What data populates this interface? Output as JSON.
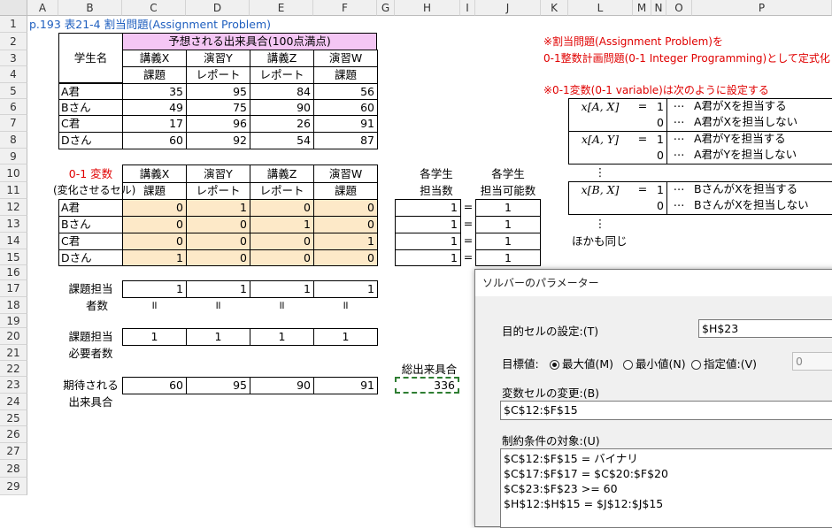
{
  "columns": [
    "A",
    "B",
    "C",
    "D",
    "E",
    "F",
    "G",
    "H",
    "I",
    "J",
    "K",
    "L",
    "M",
    "N",
    "O",
    "P"
  ],
  "rows": [
    "1",
    "2",
    "3",
    "4",
    "5",
    "6",
    "7",
    "8",
    "9",
    "10",
    "11",
    "12",
    "13",
    "14",
    "15",
    "16",
    "17",
    "18",
    "19",
    "20",
    "21",
    "22",
    "23",
    "24",
    "25",
    "26",
    "27",
    "28",
    "29"
  ],
  "title": "p.193 表21-4 割当問題(Assignment Problem)",
  "expected_header": "予想される出来具合(100点満点)",
  "student_label": "学生名",
  "lectures": [
    {
      "top": "講義X",
      "bottom": "課題"
    },
    {
      "top": "演習Y",
      "bottom": "レポート"
    },
    {
      "top": "講義Z",
      "bottom": "レポート"
    },
    {
      "top": "演習W",
      "bottom": "課題"
    }
  ],
  "students": [
    "A君",
    "Bさん",
    "C君",
    "Dさん"
  ],
  "scores": [
    [
      "35",
      "95",
      "84",
      "56"
    ],
    [
      "49",
      "75",
      "90",
      "60"
    ],
    [
      "17",
      "96",
      "26",
      "91"
    ],
    [
      "60",
      "92",
      "54",
      "87"
    ]
  ],
  "var_label": "0-1 変数",
  "var_sub": "(変化させるセル)",
  "assignment": [
    [
      "0",
      "1",
      "0",
      "0"
    ],
    [
      "0",
      "0",
      "1",
      "0"
    ],
    [
      "0",
      "0",
      "0",
      "1"
    ],
    [
      "1",
      "0",
      "0",
      "0"
    ]
  ],
  "each_student_top": "各学生",
  "count_label": "担当数",
  "possible_label": "担当可能数",
  "assigned_counts": [
    "1",
    "1",
    "1",
    "1"
  ],
  "eq": "=",
  "possible_counts": [
    "1",
    "1",
    "1",
    "1"
  ],
  "task_count_label1": "課題担当",
  "task_count_label2": "者数",
  "task_counts": [
    "1",
    "1",
    "1",
    "1"
  ],
  "eqv": "॥",
  "needed_label1": "課題担当",
  "needed_label2": "必要者数",
  "needed": [
    "1",
    "1",
    "1",
    "1"
  ],
  "expected_label1": "期待される",
  "expected_label2": "出来具合",
  "expected_values": [
    "60",
    "95",
    "90",
    "91"
  ],
  "total_label": "総出来具合",
  "total_value": "336",
  "notes": {
    "line1": "※割当問題(Assignment Problem)を",
    "line2": "0-1整数計画問題(0-1 Integer Programming)として定式化",
    "line3": "※0-1変数(0-1 variable)は次のように設定する",
    "x_ax": "x[A, X]",
    "x_ay": "x[A, Y]",
    "x_bx": "x[B, X]",
    "eq": "=",
    "one": "1",
    "zero": "0",
    "ellipsis": "⋯",
    "vdots": "⋮",
    "ax1": "A君がXを担当する",
    "ax0": "A君がXを担当しない",
    "ay1": "A君がYを担当する",
    "ay0": "A君がYを担当しない",
    "bx1": "BさんがXを担当する",
    "bx0": "BさんがXを担当しない",
    "others": "ほかも同じ"
  },
  "solver": {
    "title": "ソルバーのパラメーター",
    "objective_label": "目的セルの設定:(T)",
    "objective_value": "$H$23",
    "target_label": "目標値:",
    "max_label": "最大値(M)",
    "min_label": "最小値(N)",
    "value_label": "指定値:(V)",
    "value_value": "0",
    "variable_label": "変数セルの変更:(B)",
    "variable_value": "$C$12:$F$15",
    "constraints_label": "制約条件の対象:(U)",
    "constraints": [
      "$C$12:$F$15 = バイナリ",
      "$C$17:$F$17 = $C$20:$F$20",
      "$C$23:$F$23 >= 60",
      "$H$12:$H$15 = $J$12:$J$15"
    ]
  }
}
